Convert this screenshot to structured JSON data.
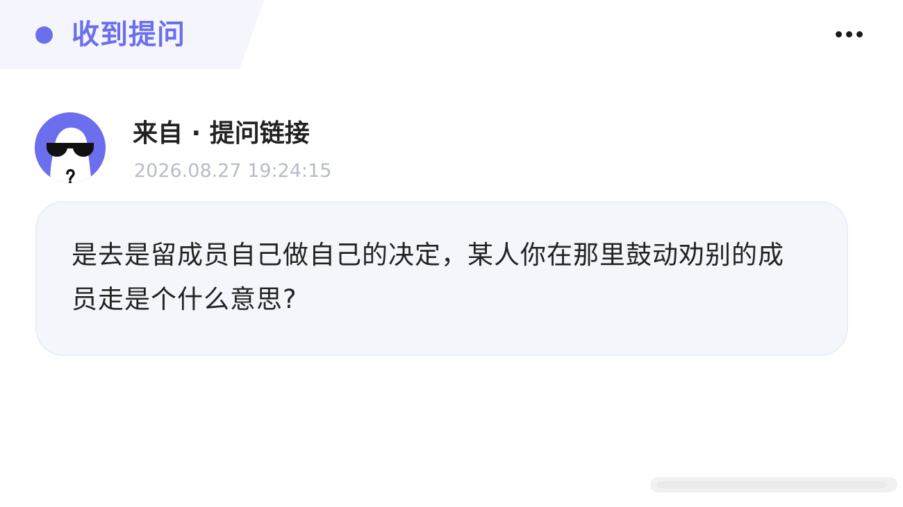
{
  "header": {
    "title": "收到提问",
    "accent_color": "#6b6fee",
    "tab_background": "#f5f6fd",
    "more_icon": "more-horizontal-icon"
  },
  "message": {
    "sender": "来自 · 提问链接",
    "timestamp": "2026.08.27 19:24:15",
    "avatar_icon": "anonymous-sunglasses-avatar",
    "avatar_color": "#6b6fee",
    "question": "是去是留成员自己做自己的决定，某人你在那里鼓动劝别的成员走是个什么意思?"
  }
}
